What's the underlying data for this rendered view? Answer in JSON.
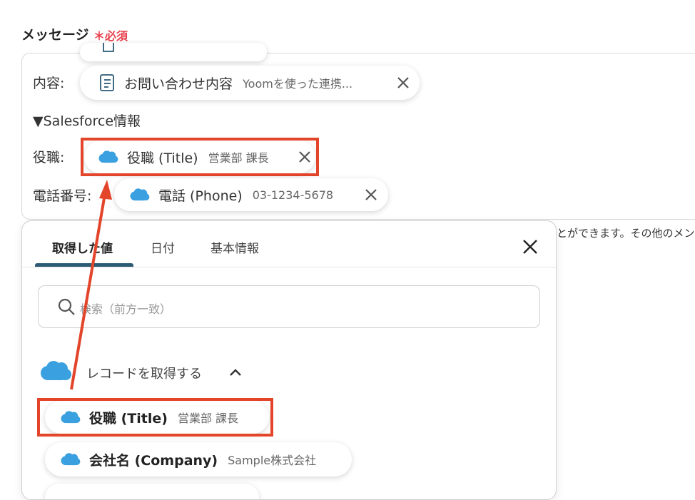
{
  "field": {
    "label": "メッセージ",
    "required": "＊必須"
  },
  "message": {
    "content_label": "内容:",
    "content_chip": {
      "title": "お問い合わせ内容",
      "value": "Yoomを使った連携..."
    },
    "section_header": "▼Salesforce情報",
    "title_label": "役職:",
    "title_chip": {
      "title": "役職 (Title)",
      "value": "営業部 課長"
    },
    "phone_label": "電話番号:",
    "phone_chip": {
      "title": "電話 (Phone)",
      "value": "03-1234-5678"
    }
  },
  "panel": {
    "tabs": [
      "取得した値",
      "日付",
      "基本情報"
    ],
    "active_tab": "取得した値",
    "search_placeholder": "検索（前方一致）",
    "group_label": "レコードを取得する",
    "items": [
      {
        "title": "役職 (Title)",
        "value": "営業部 課長"
      },
      {
        "title": "会社名 (Company)",
        "value": "Sample株式会社"
      }
    ]
  },
  "side_text": "とができます。その他のメン",
  "colors": {
    "accent": "#e3452b",
    "required": "#e8434f",
    "salesforce": "#3aa0e0",
    "tab_indicator": "#2d5a74"
  },
  "icons": [
    "document-list-icon",
    "salesforce-cloud-icon",
    "close-icon",
    "search-icon",
    "chevron-up-icon"
  ]
}
